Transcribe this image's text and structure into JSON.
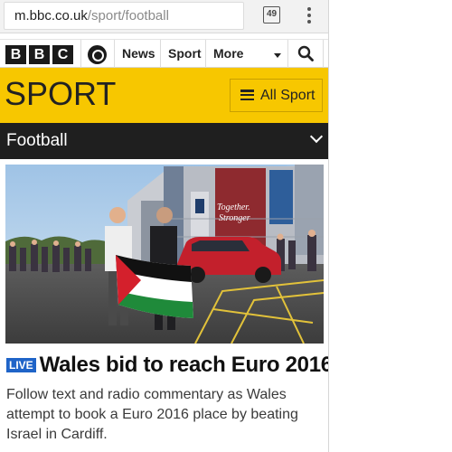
{
  "browser": {
    "url_host": "m.bbc.co.uk",
    "url_path": "/sport/football",
    "tab_count": "49"
  },
  "bbc_nav": {
    "logo_letters": [
      "B",
      "B",
      "C"
    ],
    "news_label": "News",
    "sport_label": "Sport",
    "more_label": "More"
  },
  "sport_banner": {
    "title": "SPORT",
    "all_sport_label": "All Sport"
  },
  "section": {
    "title": "Football"
  },
  "hero": {
    "stadium_banner_line1": "Together.",
    "stadium_banner_line2": "Stronger"
  },
  "article": {
    "live_badge": "LIVE",
    "headline": "Wales bid to reach Euro 2016",
    "summary": "Follow text and radio commentary as Wales attempt to book a Euro 2016 place by beating Israel in Cardiff."
  },
  "colors": {
    "sport_yellow": "#f7c700",
    "football_bar": "#1f1f1f",
    "live_blue": "#1f64c8"
  }
}
